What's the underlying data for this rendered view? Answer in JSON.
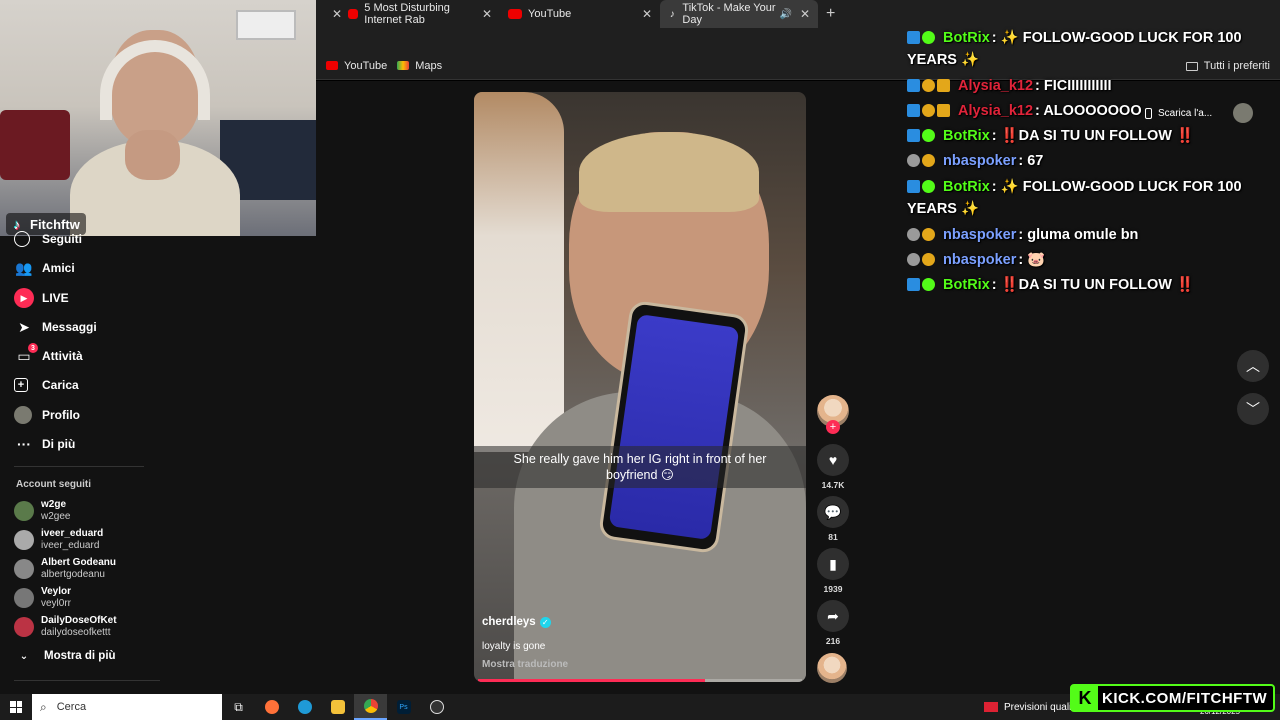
{
  "browser": {
    "tabs": [
      {
        "label": "",
        "active": false
      },
      {
        "label": "5 Most Disturbing Internet Rab",
        "active": false
      },
      {
        "label": "YouTube",
        "active": false
      },
      {
        "label": "TikTok - Make Your Day",
        "active": true
      }
    ],
    "bookmarks": [
      "YouTube",
      "Maps"
    ],
    "bookmarks_right": "Tutti i preferiti"
  },
  "streamer": {
    "name": "Fitchftw"
  },
  "sidebar": {
    "nav": [
      {
        "label": "Seguiti",
        "icon": "following-icon"
      },
      {
        "label": "Amici",
        "icon": "friends-icon"
      },
      {
        "label": "LIVE",
        "icon": "live-icon"
      },
      {
        "label": "Messaggi",
        "icon": "messages-icon"
      },
      {
        "label": "Attività",
        "icon": "activity-icon",
        "badge": "3"
      },
      {
        "label": "Carica",
        "icon": "upload-icon"
      },
      {
        "label": "Profilo",
        "icon": "profile-icon"
      },
      {
        "label": "Di più",
        "icon": "more-icon"
      }
    ],
    "accounts_title": "Account seguiti",
    "accounts": [
      {
        "name": "w2ge",
        "handle": "w2gee"
      },
      {
        "name": "iveer_eduard",
        "handle": "iveer_eduard"
      },
      {
        "name": "Albert Godeanu",
        "handle": "albertgodeanu"
      },
      {
        "name": "Veylor",
        "handle": "veyl0rr"
      },
      {
        "name": "DailyDoseOfKet",
        "handle": "dailydoseofkettt"
      }
    ],
    "show_more": "Mostra di più"
  },
  "video": {
    "caption": "She really gave him her IG right in front of her boyfriend 😏",
    "username": "cherdleys",
    "description": "loyalty is gone",
    "translate": "Mostra traduzione",
    "progress": 0.7,
    "likes": "14.7K",
    "comments": "81",
    "saves": "1939",
    "shares": "216"
  },
  "chat": {
    "messages": [
      {
        "user": "BotRix",
        "text": ": ✨ FOLLOW-GOOD LUCK FOR 100",
        "color": "green"
      },
      {
        "user": "",
        "text": "YEARS ✨",
        "color": "none"
      },
      {
        "user": "Alysia_k12",
        "text": ": FICIIIIIIIIIII",
        "color": "red"
      },
      {
        "user": "Alysia_k12",
        "text": ": ALOOOOOOO",
        "color": "red"
      },
      {
        "user": "BotRix",
        "text": ": ‼️DA SI TU UN FOLLOW ‼️",
        "color": "green"
      },
      {
        "user": "nbaspoker",
        "text": ": 67",
        "color": "blue"
      },
      {
        "user": "BotRix",
        "text": ": ✨ FOLLOW-GOOD LUCK FOR 100",
        "color": "green"
      },
      {
        "user": "",
        "text": "YEARS ✨",
        "color": "none"
      },
      {
        "user": "nbaspoker",
        "text": ": gluma omule bn",
        "color": "blue"
      },
      {
        "user": "nbaspoker",
        "text": ": 🐷",
        "color": "blue"
      },
      {
        "user": "BotRix",
        "text": ": ‼️DA SI TU UN FOLLOW ‼️",
        "color": "green"
      }
    ],
    "download_label": "Scarica l'a..."
  },
  "taskbar": {
    "search_placeholder": "Cerca",
    "weather": "Previsioni quali",
    "date": "26/12/2025"
  },
  "overlay": {
    "kick_label": "KICK.COM/FITCHFTW"
  },
  "colors": {
    "tiktok_red": "#fe2c55",
    "kick_green": "#53fc18",
    "botrix": "#53fc18",
    "alysia": "#e0243a",
    "nbaspoker": "#7ba0ff"
  }
}
